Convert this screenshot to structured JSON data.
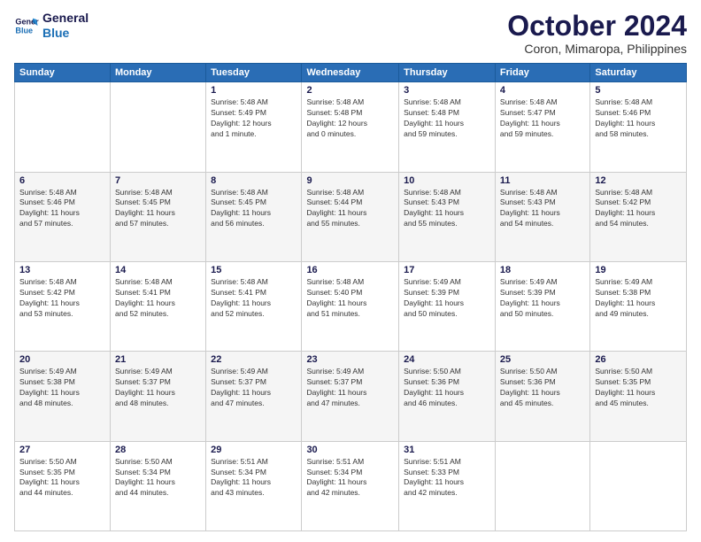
{
  "header": {
    "logo_line1": "General",
    "logo_line2": "Blue",
    "month": "October 2024",
    "location": "Coron, Mimaropa, Philippines"
  },
  "days_of_week": [
    "Sunday",
    "Monday",
    "Tuesday",
    "Wednesday",
    "Thursday",
    "Friday",
    "Saturday"
  ],
  "weeks": [
    [
      {
        "day": "",
        "detail": ""
      },
      {
        "day": "",
        "detail": ""
      },
      {
        "day": "1",
        "detail": "Sunrise: 5:48 AM\nSunset: 5:49 PM\nDaylight: 12 hours\nand 1 minute."
      },
      {
        "day": "2",
        "detail": "Sunrise: 5:48 AM\nSunset: 5:48 PM\nDaylight: 12 hours\nand 0 minutes."
      },
      {
        "day": "3",
        "detail": "Sunrise: 5:48 AM\nSunset: 5:48 PM\nDaylight: 11 hours\nand 59 minutes."
      },
      {
        "day": "4",
        "detail": "Sunrise: 5:48 AM\nSunset: 5:47 PM\nDaylight: 11 hours\nand 59 minutes."
      },
      {
        "day": "5",
        "detail": "Sunrise: 5:48 AM\nSunset: 5:46 PM\nDaylight: 11 hours\nand 58 minutes."
      }
    ],
    [
      {
        "day": "6",
        "detail": "Sunrise: 5:48 AM\nSunset: 5:46 PM\nDaylight: 11 hours\nand 57 minutes."
      },
      {
        "day": "7",
        "detail": "Sunrise: 5:48 AM\nSunset: 5:45 PM\nDaylight: 11 hours\nand 57 minutes."
      },
      {
        "day": "8",
        "detail": "Sunrise: 5:48 AM\nSunset: 5:45 PM\nDaylight: 11 hours\nand 56 minutes."
      },
      {
        "day": "9",
        "detail": "Sunrise: 5:48 AM\nSunset: 5:44 PM\nDaylight: 11 hours\nand 55 minutes."
      },
      {
        "day": "10",
        "detail": "Sunrise: 5:48 AM\nSunset: 5:43 PM\nDaylight: 11 hours\nand 55 minutes."
      },
      {
        "day": "11",
        "detail": "Sunrise: 5:48 AM\nSunset: 5:43 PM\nDaylight: 11 hours\nand 54 minutes."
      },
      {
        "day": "12",
        "detail": "Sunrise: 5:48 AM\nSunset: 5:42 PM\nDaylight: 11 hours\nand 54 minutes."
      }
    ],
    [
      {
        "day": "13",
        "detail": "Sunrise: 5:48 AM\nSunset: 5:42 PM\nDaylight: 11 hours\nand 53 minutes."
      },
      {
        "day": "14",
        "detail": "Sunrise: 5:48 AM\nSunset: 5:41 PM\nDaylight: 11 hours\nand 52 minutes."
      },
      {
        "day": "15",
        "detail": "Sunrise: 5:48 AM\nSunset: 5:41 PM\nDaylight: 11 hours\nand 52 minutes."
      },
      {
        "day": "16",
        "detail": "Sunrise: 5:48 AM\nSunset: 5:40 PM\nDaylight: 11 hours\nand 51 minutes."
      },
      {
        "day": "17",
        "detail": "Sunrise: 5:49 AM\nSunset: 5:39 PM\nDaylight: 11 hours\nand 50 minutes."
      },
      {
        "day": "18",
        "detail": "Sunrise: 5:49 AM\nSunset: 5:39 PM\nDaylight: 11 hours\nand 50 minutes."
      },
      {
        "day": "19",
        "detail": "Sunrise: 5:49 AM\nSunset: 5:38 PM\nDaylight: 11 hours\nand 49 minutes."
      }
    ],
    [
      {
        "day": "20",
        "detail": "Sunrise: 5:49 AM\nSunset: 5:38 PM\nDaylight: 11 hours\nand 48 minutes."
      },
      {
        "day": "21",
        "detail": "Sunrise: 5:49 AM\nSunset: 5:37 PM\nDaylight: 11 hours\nand 48 minutes."
      },
      {
        "day": "22",
        "detail": "Sunrise: 5:49 AM\nSunset: 5:37 PM\nDaylight: 11 hours\nand 47 minutes."
      },
      {
        "day": "23",
        "detail": "Sunrise: 5:49 AM\nSunset: 5:37 PM\nDaylight: 11 hours\nand 47 minutes."
      },
      {
        "day": "24",
        "detail": "Sunrise: 5:50 AM\nSunset: 5:36 PM\nDaylight: 11 hours\nand 46 minutes."
      },
      {
        "day": "25",
        "detail": "Sunrise: 5:50 AM\nSunset: 5:36 PM\nDaylight: 11 hours\nand 45 minutes."
      },
      {
        "day": "26",
        "detail": "Sunrise: 5:50 AM\nSunset: 5:35 PM\nDaylight: 11 hours\nand 45 minutes."
      }
    ],
    [
      {
        "day": "27",
        "detail": "Sunrise: 5:50 AM\nSunset: 5:35 PM\nDaylight: 11 hours\nand 44 minutes."
      },
      {
        "day": "28",
        "detail": "Sunrise: 5:50 AM\nSunset: 5:34 PM\nDaylight: 11 hours\nand 44 minutes."
      },
      {
        "day": "29",
        "detail": "Sunrise: 5:51 AM\nSunset: 5:34 PM\nDaylight: 11 hours\nand 43 minutes."
      },
      {
        "day": "30",
        "detail": "Sunrise: 5:51 AM\nSunset: 5:34 PM\nDaylight: 11 hours\nand 42 minutes."
      },
      {
        "day": "31",
        "detail": "Sunrise: 5:51 AM\nSunset: 5:33 PM\nDaylight: 11 hours\nand 42 minutes."
      },
      {
        "day": "",
        "detail": ""
      },
      {
        "day": "",
        "detail": ""
      }
    ]
  ]
}
